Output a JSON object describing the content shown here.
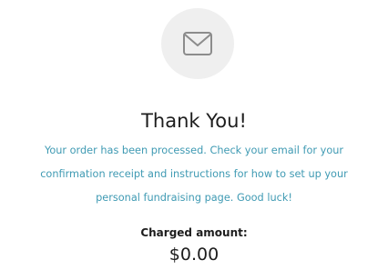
{
  "confirmation": {
    "icon": "envelope-icon",
    "title": "Thank You!",
    "message_lines": [
      "Your order has been processed. Check your email for your",
      "confirmation receipt and instructions for how to set up your",
      "personal fundraising page. Good luck!"
    ],
    "charged_label": "Charged amount:",
    "charged_value": "$0.00"
  },
  "colors": {
    "background": "#ffffff",
    "icon_circle": "#efefef",
    "icon_stroke": "#8c8c8c",
    "title": "#1d1d1d",
    "message": "#3f9ab3"
  }
}
